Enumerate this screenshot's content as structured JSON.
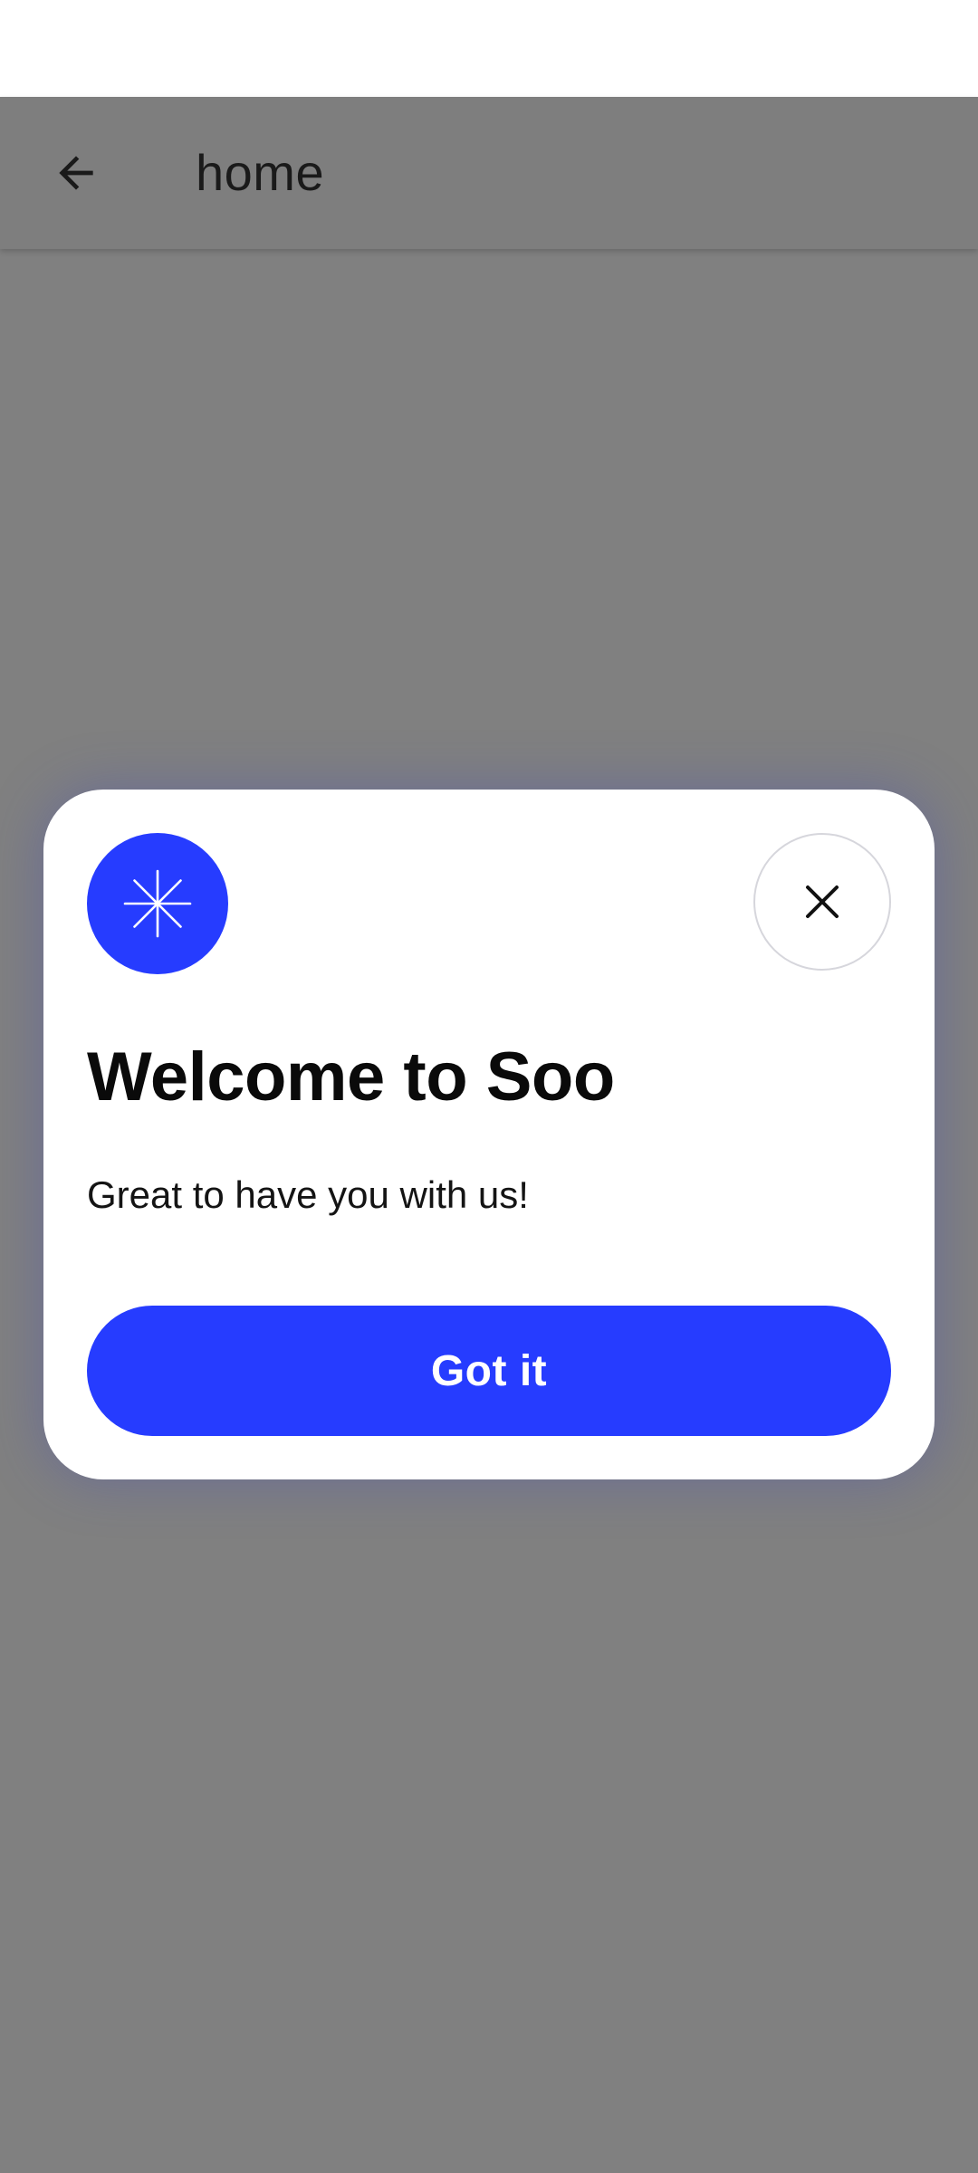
{
  "toolbar": {
    "title": "home",
    "back_icon": "arrow-left-icon"
  },
  "dialog": {
    "badge_icon": "sparkle-icon",
    "close_icon": "close-icon",
    "title": "Welcome to Soo",
    "subtitle": "Great to have you with us!",
    "primary_button_label": "Got it"
  },
  "colors": {
    "accent": "#263cff",
    "scrim": "#808080",
    "surface": "#ffffff"
  }
}
